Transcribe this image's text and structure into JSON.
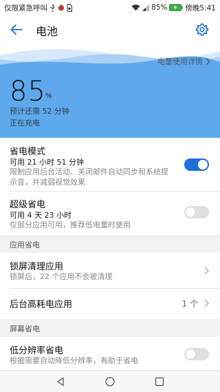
{
  "status_bar": {
    "left_text": "仅限紧急呼叫",
    "battery_percent": "85%",
    "time": "傍晚5:41"
  },
  "header": {
    "title": "电池"
  },
  "hero": {
    "usage_link": "电量使用详情",
    "percent": "85",
    "percent_sign": "%",
    "remaining": "预计还需 52 分钟",
    "charging": "正在充电",
    "accent_color": "#5ea9ec"
  },
  "items": {
    "power_saving": {
      "title": "省电模式",
      "sub": "可用 21 小时 51 分钟",
      "desc": "限制应用后台活动、关闭邮件自动同步和系统提示音，并减弱视觉效果",
      "toggle_on": true
    },
    "super_saving": {
      "title": "超级省电",
      "sub": "可用 4 天 23 小时",
      "desc": "仅部分应用可用，推荐低电量时使用",
      "toggle_on": false
    },
    "lock_clean": {
      "title": "锁屏清理应用",
      "desc": "锁屏后，22 个应用不会被清理"
    },
    "background_high": {
      "title": "后台高耗电应用",
      "count": "1 个"
    },
    "low_resolution": {
      "title": "低分辨率省电",
      "desc": "根据需要自动降低分辨率，有助于省电",
      "toggle_on": false
    }
  },
  "sections": {
    "app_saving": "应用省电",
    "screen_saving": "屏幕省电"
  },
  "colors": {
    "primary": "#1e6fd9"
  }
}
